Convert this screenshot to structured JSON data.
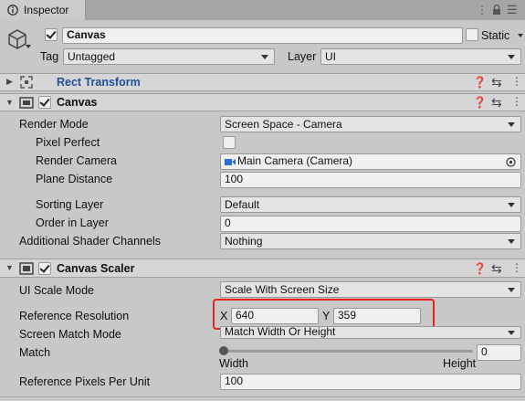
{
  "tab": {
    "title": "Inspector"
  },
  "object": {
    "name": "Canvas",
    "static_label": "Static",
    "tag_label": "Tag",
    "tag_value": "Untagged",
    "layer_label": "Layer",
    "layer_value": "UI"
  },
  "rect_transform": {
    "title": "Rect Transform"
  },
  "canvas": {
    "title": "Canvas",
    "render_mode_label": "Render Mode",
    "render_mode_value": "Screen Space - Camera",
    "pixel_perfect_label": "Pixel Perfect",
    "render_camera_label": "Render Camera",
    "render_camera_value": "Main Camera (Camera)",
    "plane_distance_label": "Plane Distance",
    "plane_distance_value": "100",
    "sorting_layer_label": "Sorting Layer",
    "sorting_layer_value": "Default",
    "order_in_layer_label": "Order in Layer",
    "order_in_layer_value": "0",
    "shader_channels_label": "Additional Shader Channels",
    "shader_channels_value": "Nothing"
  },
  "canvas_scaler": {
    "title": "Canvas Scaler",
    "ui_scale_mode_label": "UI Scale Mode",
    "ui_scale_mode_value": "Scale With Screen Size",
    "reference_resolution_label": "Reference Resolution",
    "x_label": "X",
    "x_value": "640",
    "y_label": "Y",
    "y_value": "359",
    "screen_match_mode_label": "Screen Match Mode",
    "screen_match_mode_value": "Match Width Or Height",
    "match_label": "Match",
    "match_value": "0",
    "match_fraction": 0,
    "width_label": "Width",
    "height_label": "Height",
    "pixels_per_unit_label": "Reference Pixels Per Unit",
    "pixels_per_unit_value": "100"
  },
  "icons": {
    "cube": "cube-icon",
    "help": "help-icon",
    "settings": "settings-icon",
    "menu": "more-vert-icon",
    "lock": "lock-icon",
    "camera": "camera-icon",
    "target": "object-picker-icon"
  },
  "colors": {
    "highlight": "#e5231a",
    "header_link": "#1f4e9a"
  }
}
